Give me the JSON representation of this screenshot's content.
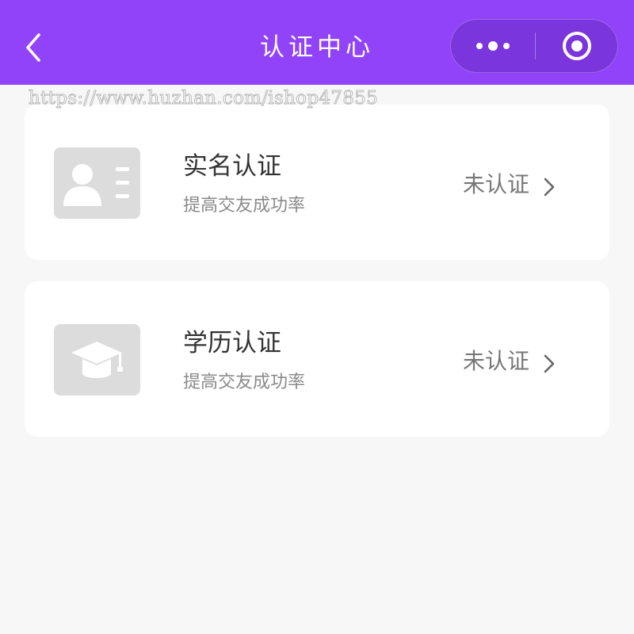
{
  "header": {
    "title": "认证中心",
    "background_color": "#9143fa",
    "back_icon": "chevron-left-icon",
    "more_icon": "more-dots-icon",
    "close_icon": "target-circle-icon"
  },
  "watermark": "https://www.huzhan.com/ishop47855",
  "cards": [
    {
      "title": "实名认证",
      "subtitle": "提高交友成功率",
      "status": "未认证",
      "icon": "id-card-icon"
    },
    {
      "title": "学历认证",
      "subtitle": "提高交友成功率",
      "status": "未认证",
      "icon": "graduation-cap-icon"
    }
  ]
}
